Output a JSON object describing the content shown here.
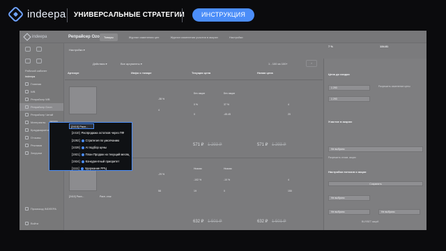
{
  "banner": {
    "logo_text": "indeepa",
    "title": "УНИВЕРСАЛЬНЫЕ СТРАТЕГИИ",
    "button_label": "ИНСТРУКЦИЯ"
  },
  "app": {
    "logo_text": "indeepa",
    "title": "Репрайсер Ozon",
    "tabs": [
      "Товары",
      "Журнал изменения цен",
      "Журнал изменения участия в акциях",
      "Настройки"
    ],
    "active_tab": "Товары",
    "settings_dropdown": "Настройки",
    "workspace_label": "Рабочий кабинет",
    "workspace_value": "indeepa"
  },
  "sidebar": {
    "items": [
      "Главная",
      "WB",
      "Репрайсер WB",
      "Репрайсер Ozon",
      "Репрайсер Читай",
      "Материалы",
      "Краудмаркетинг",
      "Отзывы",
      "Реклама",
      "Загрузки"
    ],
    "active": "Репрайсер Ozon",
    "badge": "Beta",
    "bottom_items": [
      "Промокод INDEEPA",
      "Войти"
    ]
  },
  "toolbar": {
    "action_label": "Действия",
    "filters_label": "Все аргументы",
    "apply_label": "Применить",
    "pagination": "1 - 100 из 100+"
  },
  "columns": [
    "Артикул",
    "Инфо о товаре",
    "Текущая цена",
    "Новая цена"
  ],
  "rows": [
    {
      "tag": "[2410] Расп...",
      "info": "Расп. сток",
      "stats_left": [
        "-38 %",
        "4"
      ],
      "stats_mid": [
        "Без акции",
        "Без акции",
        "0 %",
        "0"
      ],
      "stats_right": [
        "37 %",
        "-45.45",
        "4",
        "20"
      ],
      "price": "571 ₽",
      "old_price": "1 293 ₽",
      "new_price": "571 ₽",
      "new_old_price": "1 293 ₽"
    },
    {
      "tag": "[2410] Расп...",
      "info": "Расп. сток",
      "stats_left": [
        "-29 %",
        "58"
      ],
      "stats_mid": [
        "Низкая",
        "Низкая",
        "-102 %",
        "19"
      ],
      "stats_right": [
        "-10 %",
        "0",
        "4",
        "150"
      ],
      "price": "632 ₽",
      "old_price": "1 501 ₽",
      "new_price": "632 ₽",
      "new_old_price": "1 501 ₽"
    }
  ],
  "popover": {
    "selected_tag": "[2410] Расп...",
    "items": [
      {
        "code": "[2410]",
        "label": "Распродажа остатков через ПФ"
      },
      {
        "code": "[2292]",
        "label": "Стратегия по умолчанию"
      },
      {
        "code": "[1029]",
        "label": "AI подбор цены"
      },
      {
        "code": "[1921]",
        "label": "План Продаж на текущий месяц"
      },
      {
        "code": "[1924]",
        "label": "Конкурентный приоритет"
      },
      {
        "code": "[1111]",
        "label": "Удержание РРЦ"
      }
    ]
  },
  "right_panel": {
    "top_values": [
      "7 %",
      "134.81"
    ],
    "sections": [
      {
        "title": "Цена до скидки",
        "fields": [
          "1 293",
          "1 293"
        ],
        "checkbox": "Разрешить изменение цены"
      },
      {
        "title": "Участие в акциях",
        "fields": [
          "Не выбрано"
        ],
        "checkbox": "Разрешить отзыв. акции"
      },
      {
        "title": "Настройки потоков и акции",
        "fields": [
          "Не выбрано",
          "Не выбрано",
          "Не выбрано"
        ],
        "note": "BUYBET акций"
      }
    ],
    "button_label": "Сохранить"
  }
}
